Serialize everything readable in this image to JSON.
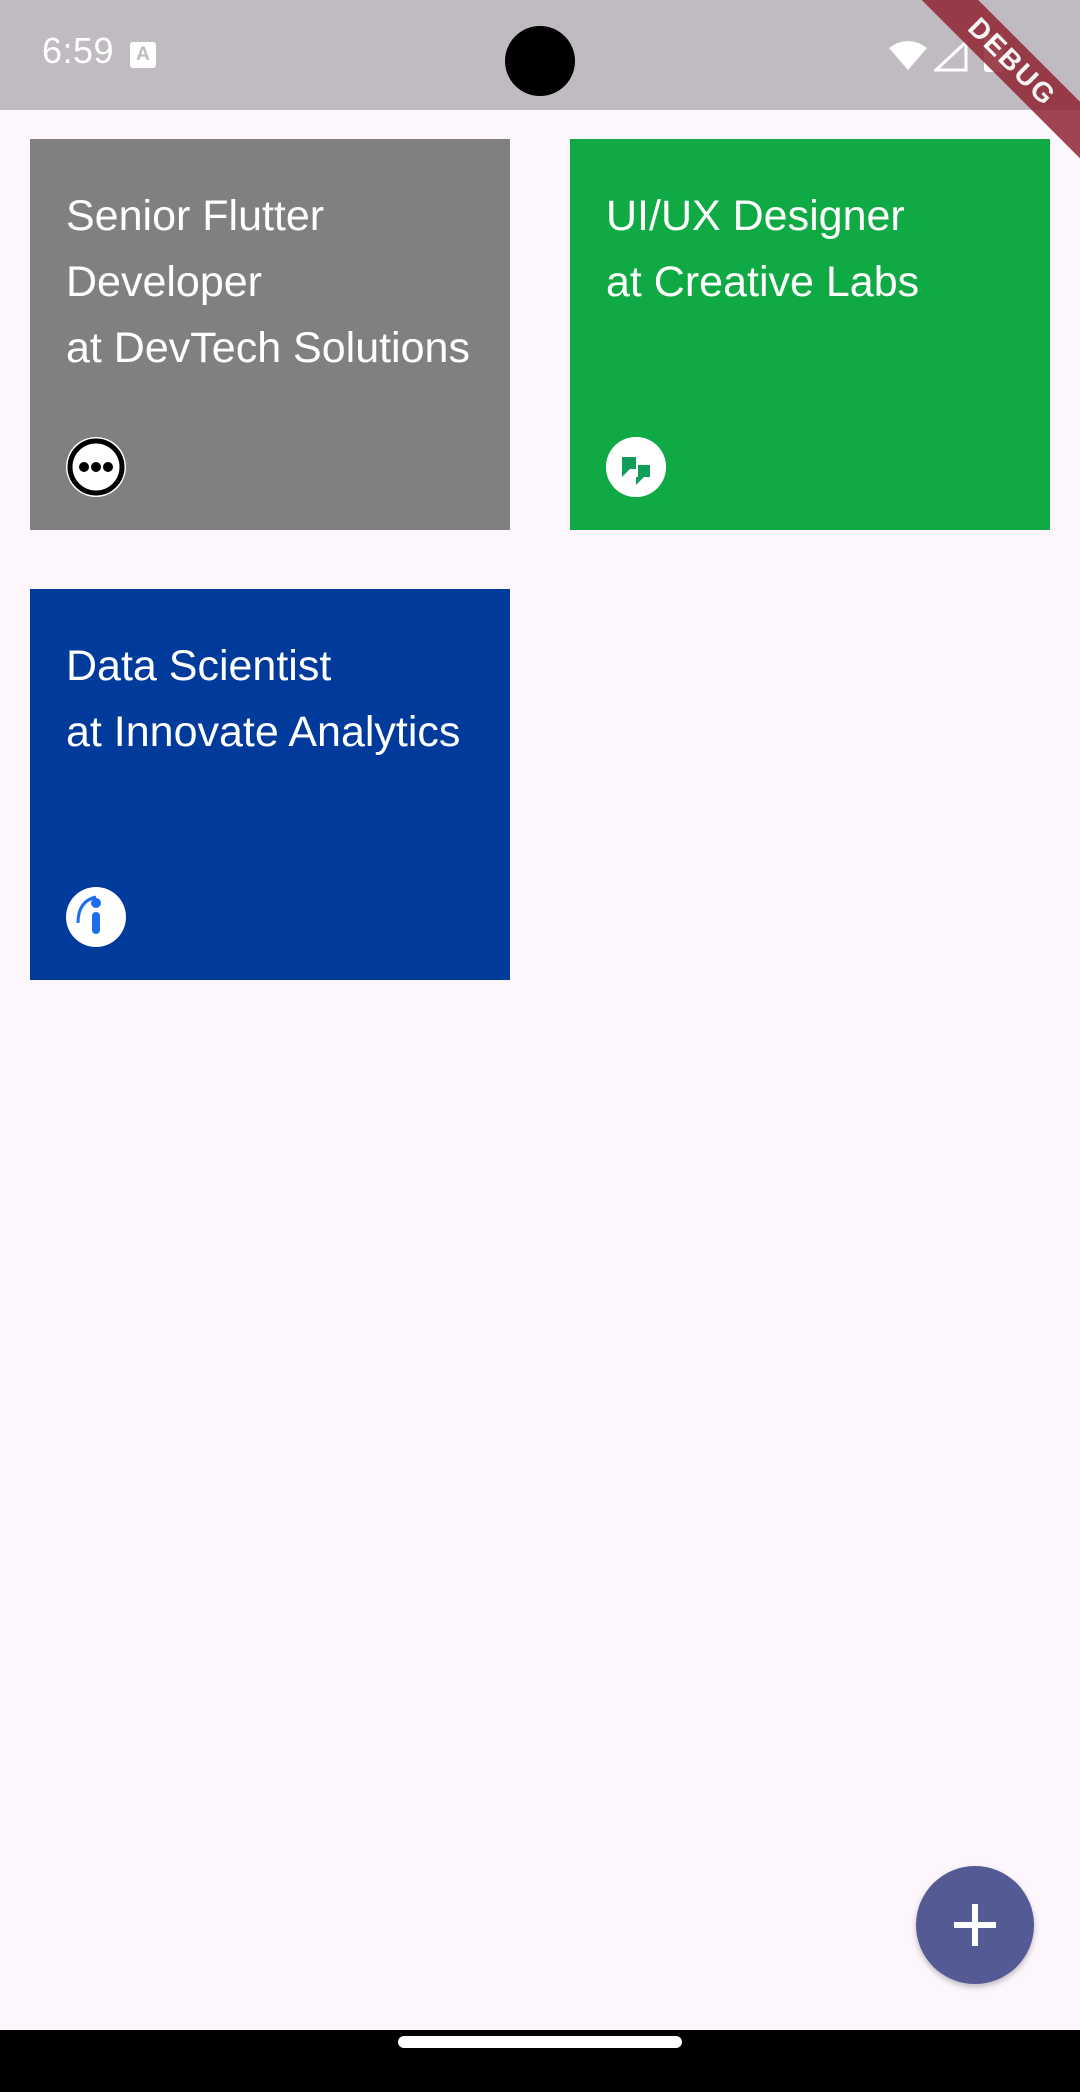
{
  "status_bar": {
    "time": "6:59"
  },
  "debug_banner": "DEBUG",
  "jobs": [
    {
      "title_line1": "Senior Flutter",
      "title_line2": "Developer",
      "company_line": "at DevTech Solutions",
      "card_color": "#808080",
      "logo_icon": "more-horizontal-icon"
    },
    {
      "title_line1": "UI/UX Designer",
      "company_line": "at Creative Labs",
      "card_color": "#0FAA43",
      "logo_icon": "quote-icon"
    },
    {
      "title_line1": "Data Scientist",
      "company_line": "at Innovate Analytics",
      "card_color": "#003A9B",
      "logo_icon": "info-icon"
    }
  ],
  "fab": {
    "icon": "plus-icon",
    "color": "#535A94"
  }
}
